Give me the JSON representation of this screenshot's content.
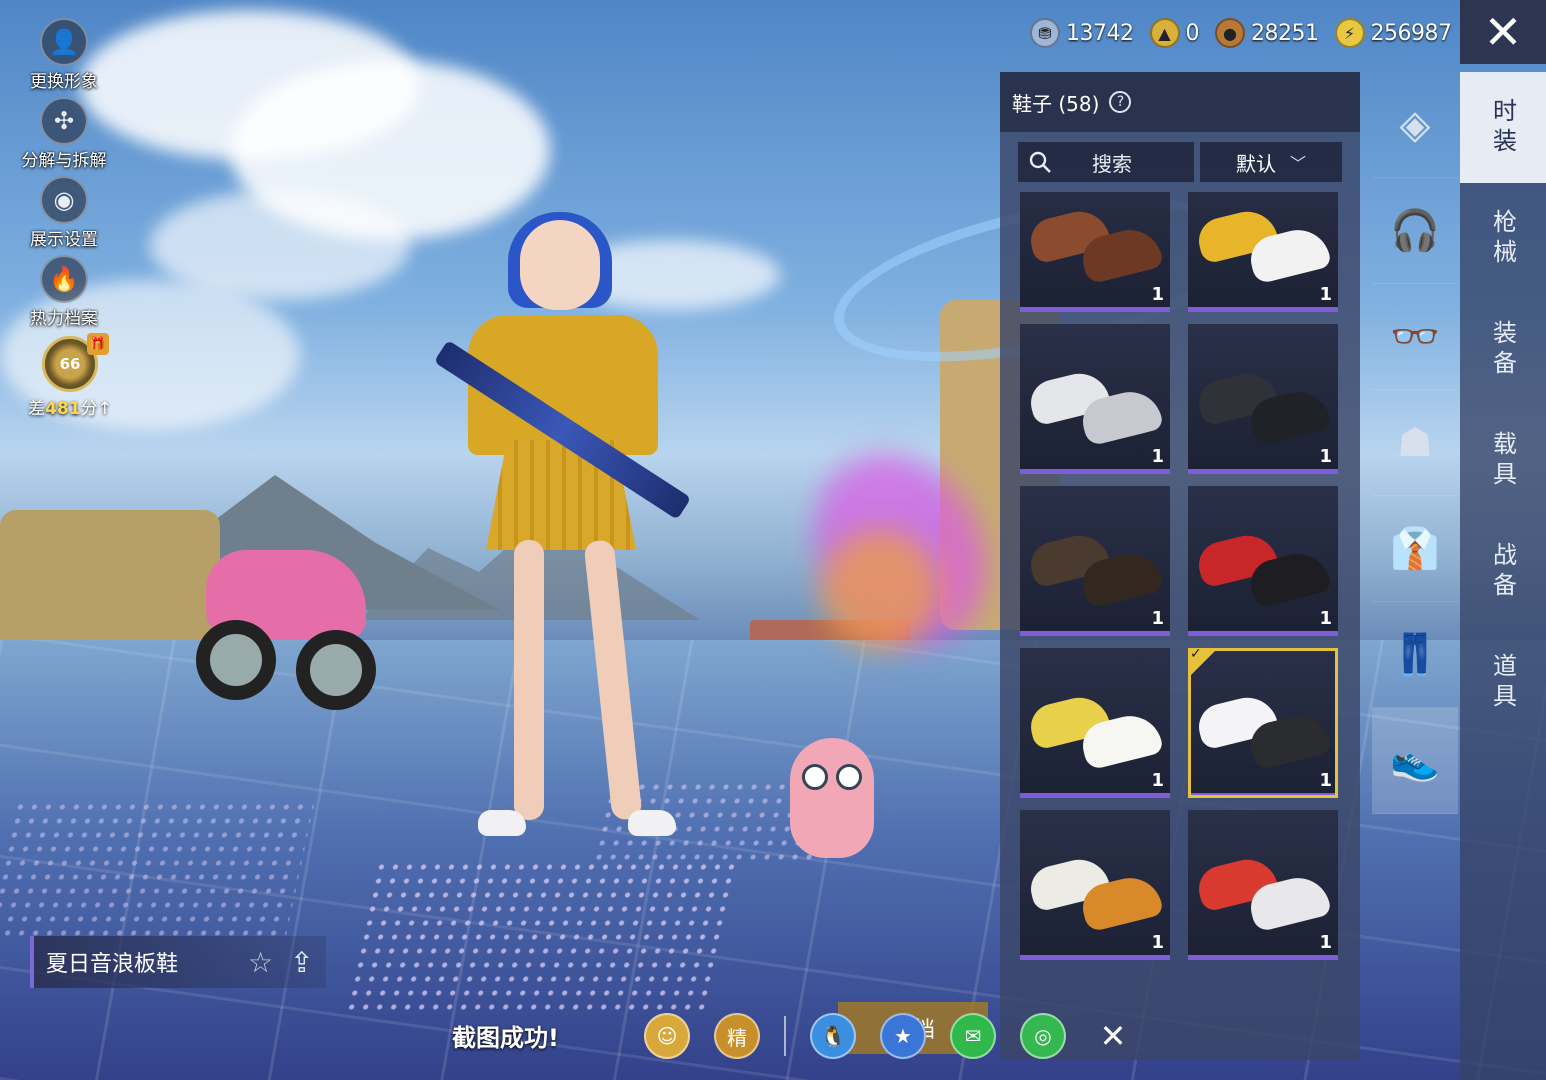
{
  "currency": [
    {
      "icon": "bp-coin-icon",
      "symbol": "⛃",
      "color": "#9fb6d8",
      "value": "13742"
    },
    {
      "icon": "gold-badge-icon",
      "symbol": "▲",
      "color": "#d9b13a",
      "value": "0"
    },
    {
      "icon": "copper-coin-icon",
      "symbol": "●",
      "color": "#b8783a",
      "value": "28251"
    },
    {
      "icon": "lightning-coin-icon",
      "symbol": "⚡",
      "color": "#e8c840",
      "value": "256987"
    }
  ],
  "close_symbol": "✕",
  "left_menu": [
    {
      "name": "change-avatar",
      "icon": "avatar-icon",
      "symbol": "👤",
      "label": "更换形象"
    },
    {
      "name": "decompose",
      "icon": "puzzle-icon",
      "symbol": "✣",
      "label": "分解与拆解"
    },
    {
      "name": "display-settings",
      "icon": "eye-icon",
      "symbol": "◉",
      "label": "展示设置"
    },
    {
      "name": "heat-archive",
      "icon": "flame-icon",
      "symbol": "🔥",
      "label": "热力档案"
    }
  ],
  "rank": {
    "level": "66",
    "prefix": "差",
    "points": "481",
    "suffix": "分",
    "arrow": "↑",
    "gift_symbol": "🎁"
  },
  "panel": {
    "title": "鞋子 (58)",
    "help_symbol": "?",
    "search_placeholder": "搜索",
    "sort_label": "默认",
    "sort_chevron": "﹀",
    "check_mark": "✓"
  },
  "items": [
    {
      "count": "1",
      "colors": [
        "#8b4b2e",
        "#6c3a24"
      ],
      "selected": false
    },
    {
      "count": "1",
      "colors": [
        "#e8b52a",
        "#f2f2f2"
      ],
      "selected": false
    },
    {
      "count": "1",
      "colors": [
        "#e4e6ea",
        "#c6cad0"
      ],
      "selected": false
    },
    {
      "count": "1",
      "colors": [
        "#2f3238",
        "#1f2226"
      ],
      "selected": false
    },
    {
      "count": "1",
      "colors": [
        "#4a3a30",
        "#332820"
      ],
      "selected": false
    },
    {
      "count": "1",
      "colors": [
        "#c8272a",
        "#1e1e22"
      ],
      "selected": false
    },
    {
      "count": "1",
      "colors": [
        "#e8d04a",
        "#f6f6f2"
      ],
      "selected": false
    },
    {
      "count": "1",
      "colors": [
        "#f4f4f6",
        "#2a2c30"
      ],
      "selected": true
    },
    {
      "count": "1",
      "colors": [
        "#ecebe4",
        "#d88a2a"
      ],
      "selected": false
    },
    {
      "count": "1",
      "colors": [
        "#d83a30",
        "#e8e8ea"
      ],
      "selected": false
    }
  ],
  "icon_tabs": [
    {
      "name": "wardrobe-box-icon",
      "symbol": "◈",
      "active": false
    },
    {
      "name": "headphones-icon",
      "symbol": "🎧",
      "active": false
    },
    {
      "name": "glasses-icon",
      "symbol": "👓",
      "active": false
    },
    {
      "name": "mask-icon",
      "symbol": "☗",
      "active": false
    },
    {
      "name": "suit-icon",
      "symbol": "👔",
      "active": false
    },
    {
      "name": "pants-icon",
      "symbol": "👖",
      "active": false
    },
    {
      "name": "shoes-icon",
      "symbol": "👟",
      "active": true
    }
  ],
  "vtabs": [
    {
      "label": "时装",
      "active": true
    },
    {
      "label": "枪械",
      "active": false
    },
    {
      "label": "装备",
      "active": false
    },
    {
      "label": "载具",
      "active": false
    },
    {
      "label": "战备",
      "active": false
    },
    {
      "label": "道具",
      "active": false
    }
  ],
  "selected_item": {
    "name": "夏日音浪板鞋",
    "star_symbol": "☆",
    "share_symbol": "⇪"
  },
  "toast": "截图成功!",
  "save_button": "存档",
  "share_bar": [
    {
      "name": "game-center-share-icon",
      "symbol": "☺",
      "color": "#d8a93a"
    },
    {
      "name": "peace-elite-share-icon",
      "symbol": "精",
      "color": "#c8902a"
    },
    {
      "name": "qq-share-icon",
      "symbol": "🐧",
      "color": "#3a8fe0"
    },
    {
      "name": "qzone-share-icon",
      "symbol": "★",
      "color": "#3a76d8"
    },
    {
      "name": "wechat-share-icon",
      "symbol": "✉",
      "color": "#2fb94a"
    },
    {
      "name": "moments-share-icon",
      "symbol": "◎",
      "color": "#36b850"
    }
  ],
  "share_close_symbol": "✕"
}
